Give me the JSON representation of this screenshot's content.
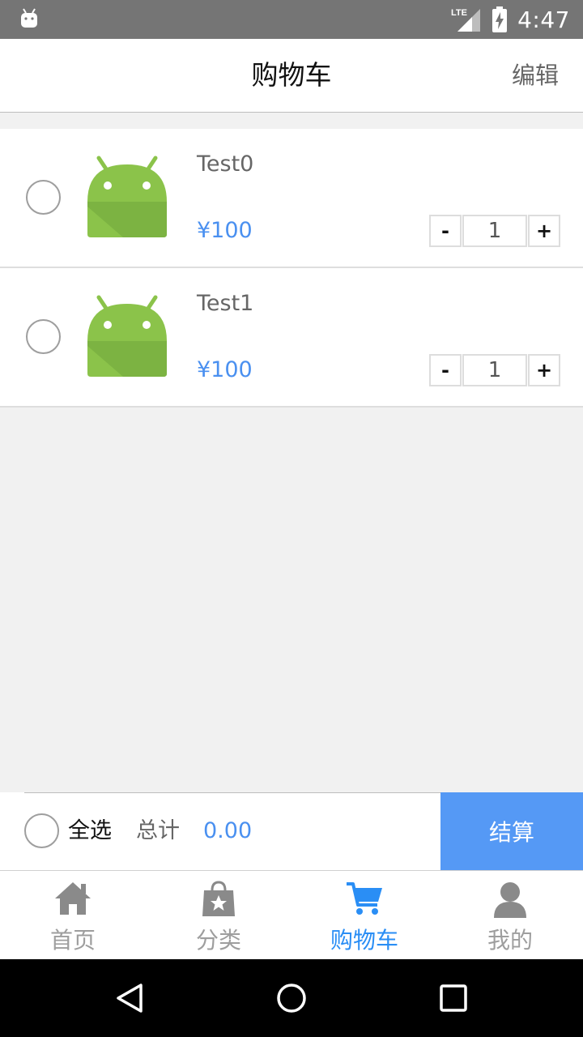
{
  "status_bar": {
    "time": "4:47",
    "network": "LTE"
  },
  "app_bar": {
    "title": "购物车",
    "edit_label": "编辑"
  },
  "cart": {
    "items": [
      {
        "name": "Test0",
        "price": "¥100",
        "quantity": "1",
        "minus": "-",
        "plus": "+",
        "checked": false
      },
      {
        "name": "Test1",
        "price": "¥100",
        "quantity": "1",
        "minus": "-",
        "plus": "+",
        "checked": false
      }
    ]
  },
  "checkout": {
    "select_all_label": "全选",
    "total_label": "总计",
    "total_value": "0.00",
    "checkout_label": "结算"
  },
  "tabs": [
    {
      "label": "首页",
      "icon": "home-icon",
      "active": false
    },
    {
      "label": "分类",
      "icon": "category-bag-icon",
      "active": false
    },
    {
      "label": "购物车",
      "icon": "cart-icon",
      "active": true
    },
    {
      "label": "我的",
      "icon": "person-icon",
      "active": false
    }
  ],
  "colors": {
    "accent": "#4a90f0",
    "checkout_button": "#5599f5",
    "tab_active": "#2a8ef5",
    "tab_inactive": "#9e9e9e"
  }
}
